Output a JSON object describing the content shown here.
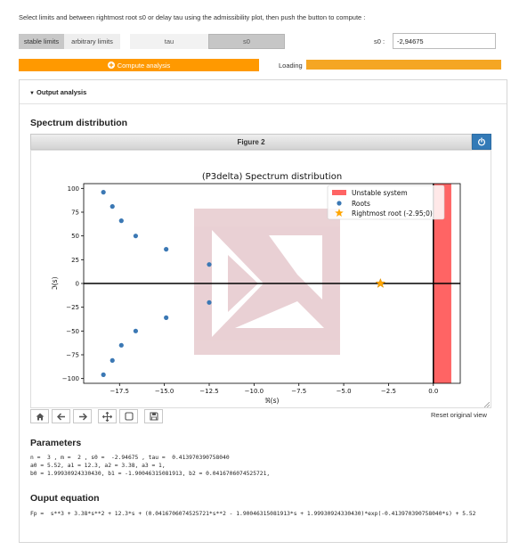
{
  "instructions": "Select limits and between rightmost root s0 or delay tau using the admissibility plot, then push the button to compute :",
  "limits": {
    "stable": "stable limits",
    "arbitrary": "arbitrary limits"
  },
  "mode": {
    "tau": "tau",
    "s0": "s0"
  },
  "s0_field": {
    "label": "s0 :",
    "value": "-2,94675"
  },
  "compute_label": "Compute analysis",
  "loading_label": "Loading",
  "output_heading": "Output analysis",
  "spectrum": {
    "heading": "Spectrum distribution",
    "figure_label": "Figure 2",
    "reset_label": "Reset original view",
    "toolbar_icons": [
      "home-icon",
      "back-arrow-icon",
      "forward-arrow-icon",
      "pan-icon",
      "zoom-rect-icon",
      "save-icon"
    ]
  },
  "chart_data": {
    "type": "scatter",
    "title": "(P3delta) Spectrum distribution",
    "xlabel": "ℜ(s)",
    "ylabel": "ℑ(s)",
    "xlim": [
      -19.5,
      1.5
    ],
    "ylim": [
      -105,
      105
    ],
    "xticks": [
      -17.5,
      -15.0,
      -12.5,
      -10.0,
      -7.5,
      -5.0,
      -2.5,
      0.0
    ],
    "xtick_labels": [
      "−17.5",
      "−15.0",
      "−12.5",
      "−10.0",
      "−7.5",
      "−5.0",
      "−2.5",
      "0.0"
    ],
    "yticks": [
      100,
      75,
      50,
      25,
      0,
      -25,
      -50,
      -75,
      -100
    ],
    "ytick_labels": [
      "100",
      "75",
      "50",
      "25",
      "0",
      "−25",
      "−50",
      "−75",
      "−100"
    ],
    "unstable_region": {
      "x_from": 0.0,
      "x_to": 1.0,
      "color": "#ff3030",
      "label": "Unstable system"
    },
    "series": [
      {
        "name": "Roots",
        "color": "#3b78b4",
        "points": [
          [
            -18.4,
            96
          ],
          [
            -17.9,
            81
          ],
          [
            -17.4,
            66
          ],
          [
            -16.6,
            50
          ],
          [
            -14.9,
            36
          ],
          [
            -12.5,
            20
          ],
          [
            -12.5,
            -20
          ],
          [
            -14.9,
            -36
          ],
          [
            -16.6,
            -50
          ],
          [
            -17.4,
            -65
          ],
          [
            -17.9,
            -81
          ],
          [
            -18.4,
            -96
          ]
        ]
      },
      {
        "name": "Rightmost root (-2.95;0)",
        "color": "#ffa500",
        "marker": "star",
        "points": [
          [
            -2.95,
            0
          ]
        ]
      }
    ],
    "legend_position": "top-right",
    "grid": false
  },
  "parameters": {
    "heading": "Parameters",
    "line1": "n =  3 , m =  2 , s0 =  -2.94675 , tau =  0.413970390758040",
    "line2": "a0 = 5.52, a1 = 12.3, a2 = 3.38, a3 = 1,",
    "line3": "b0 = 1.99930924330430, b1 = -1.90046315081913, b2 = 0.0416706074525721,"
  },
  "equation": {
    "heading": "Ouput equation",
    "line1": "Fp =  s**3 + 3.38*s**2 + 12.3*s + (0.0416706074525721*s**2 - 1.90046315081913*s + 1.99930924330430)*exp(-0.413970390758040*s) + 5.52"
  }
}
